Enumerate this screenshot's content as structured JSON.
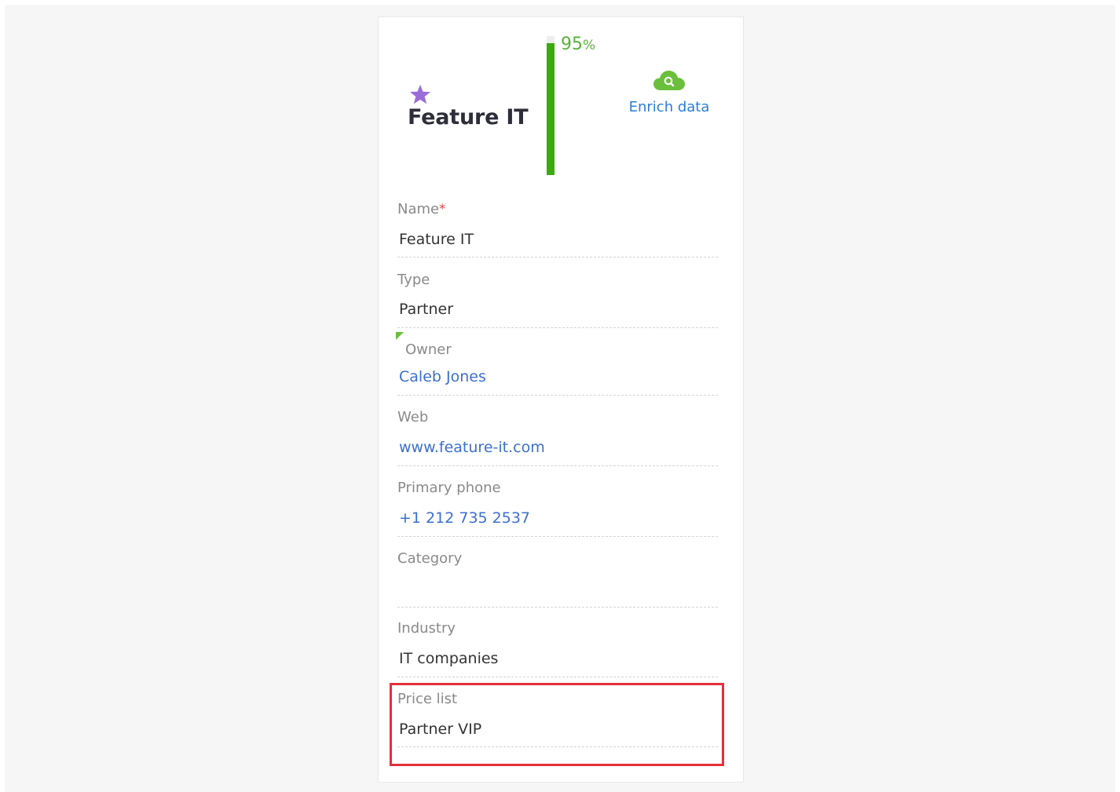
{
  "header": {
    "logo_text": "Feature IT",
    "completeness_value": "95",
    "completeness_unit": "%",
    "completeness_fraction": 0.95,
    "enrich_label": "Enrich data"
  },
  "fields": {
    "name": {
      "label": "Name",
      "required_mark": "*",
      "value": "Feature IT"
    },
    "type": {
      "label": "Type",
      "value": "Partner"
    },
    "owner": {
      "label": "Owner",
      "value": "Caleb Jones"
    },
    "web": {
      "label": "Web",
      "value": "www.feature-it.com"
    },
    "phone": {
      "label": "Primary phone",
      "value": "+1 212 735 2537"
    },
    "category": {
      "label": "Category",
      "value": ""
    },
    "industry": {
      "label": "Industry",
      "value": "IT companies"
    },
    "price_list": {
      "label": "Price list",
      "value": "Partner VIP"
    }
  },
  "colors": {
    "accent_green": "#3aaa0c",
    "link_blue": "#3c6fcf",
    "highlight_red": "#e3303a",
    "star_purple": "#9b6dd6"
  },
  "icons": {
    "logo": "star-icon",
    "enrich": "cloud-search-icon"
  }
}
